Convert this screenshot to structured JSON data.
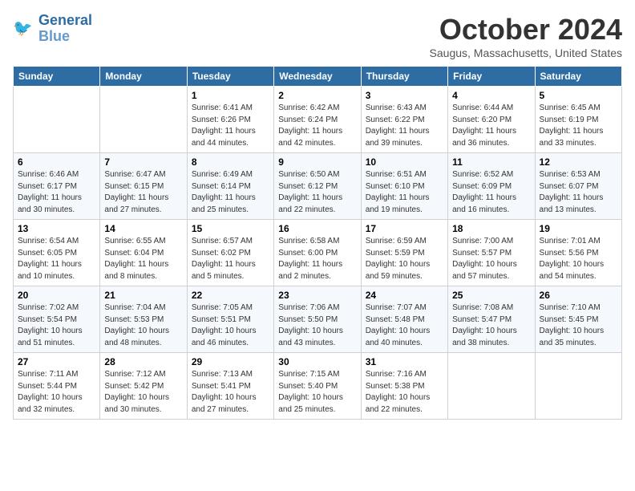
{
  "logo": {
    "line1": "General",
    "line2": "Blue"
  },
  "title": "October 2024",
  "location": "Saugus, Massachusetts, United States",
  "days_header": [
    "Sunday",
    "Monday",
    "Tuesday",
    "Wednesday",
    "Thursday",
    "Friday",
    "Saturday"
  ],
  "weeks": [
    [
      {
        "day": "",
        "sunrise": "",
        "sunset": "",
        "daylight": ""
      },
      {
        "day": "",
        "sunrise": "",
        "sunset": "",
        "daylight": ""
      },
      {
        "day": "1",
        "sunrise": "Sunrise: 6:41 AM",
        "sunset": "Sunset: 6:26 PM",
        "daylight": "Daylight: 11 hours and 44 minutes."
      },
      {
        "day": "2",
        "sunrise": "Sunrise: 6:42 AM",
        "sunset": "Sunset: 6:24 PM",
        "daylight": "Daylight: 11 hours and 42 minutes."
      },
      {
        "day": "3",
        "sunrise": "Sunrise: 6:43 AM",
        "sunset": "Sunset: 6:22 PM",
        "daylight": "Daylight: 11 hours and 39 minutes."
      },
      {
        "day": "4",
        "sunrise": "Sunrise: 6:44 AM",
        "sunset": "Sunset: 6:20 PM",
        "daylight": "Daylight: 11 hours and 36 minutes."
      },
      {
        "day": "5",
        "sunrise": "Sunrise: 6:45 AM",
        "sunset": "Sunset: 6:19 PM",
        "daylight": "Daylight: 11 hours and 33 minutes."
      }
    ],
    [
      {
        "day": "6",
        "sunrise": "Sunrise: 6:46 AM",
        "sunset": "Sunset: 6:17 PM",
        "daylight": "Daylight: 11 hours and 30 minutes."
      },
      {
        "day": "7",
        "sunrise": "Sunrise: 6:47 AM",
        "sunset": "Sunset: 6:15 PM",
        "daylight": "Daylight: 11 hours and 27 minutes."
      },
      {
        "day": "8",
        "sunrise": "Sunrise: 6:49 AM",
        "sunset": "Sunset: 6:14 PM",
        "daylight": "Daylight: 11 hours and 25 minutes."
      },
      {
        "day": "9",
        "sunrise": "Sunrise: 6:50 AM",
        "sunset": "Sunset: 6:12 PM",
        "daylight": "Daylight: 11 hours and 22 minutes."
      },
      {
        "day": "10",
        "sunrise": "Sunrise: 6:51 AM",
        "sunset": "Sunset: 6:10 PM",
        "daylight": "Daylight: 11 hours and 19 minutes."
      },
      {
        "day": "11",
        "sunrise": "Sunrise: 6:52 AM",
        "sunset": "Sunset: 6:09 PM",
        "daylight": "Daylight: 11 hours and 16 minutes."
      },
      {
        "day": "12",
        "sunrise": "Sunrise: 6:53 AM",
        "sunset": "Sunset: 6:07 PM",
        "daylight": "Daylight: 11 hours and 13 minutes."
      }
    ],
    [
      {
        "day": "13",
        "sunrise": "Sunrise: 6:54 AM",
        "sunset": "Sunset: 6:05 PM",
        "daylight": "Daylight: 11 hours and 10 minutes."
      },
      {
        "day": "14",
        "sunrise": "Sunrise: 6:55 AM",
        "sunset": "Sunset: 6:04 PM",
        "daylight": "Daylight: 11 hours and 8 minutes."
      },
      {
        "day": "15",
        "sunrise": "Sunrise: 6:57 AM",
        "sunset": "Sunset: 6:02 PM",
        "daylight": "Daylight: 11 hours and 5 minutes."
      },
      {
        "day": "16",
        "sunrise": "Sunrise: 6:58 AM",
        "sunset": "Sunset: 6:00 PM",
        "daylight": "Daylight: 11 hours and 2 minutes."
      },
      {
        "day": "17",
        "sunrise": "Sunrise: 6:59 AM",
        "sunset": "Sunset: 5:59 PM",
        "daylight": "Daylight: 10 hours and 59 minutes."
      },
      {
        "day": "18",
        "sunrise": "Sunrise: 7:00 AM",
        "sunset": "Sunset: 5:57 PM",
        "daylight": "Daylight: 10 hours and 57 minutes."
      },
      {
        "day": "19",
        "sunrise": "Sunrise: 7:01 AM",
        "sunset": "Sunset: 5:56 PM",
        "daylight": "Daylight: 10 hours and 54 minutes."
      }
    ],
    [
      {
        "day": "20",
        "sunrise": "Sunrise: 7:02 AM",
        "sunset": "Sunset: 5:54 PM",
        "daylight": "Daylight: 10 hours and 51 minutes."
      },
      {
        "day": "21",
        "sunrise": "Sunrise: 7:04 AM",
        "sunset": "Sunset: 5:53 PM",
        "daylight": "Daylight: 10 hours and 48 minutes."
      },
      {
        "day": "22",
        "sunrise": "Sunrise: 7:05 AM",
        "sunset": "Sunset: 5:51 PM",
        "daylight": "Daylight: 10 hours and 46 minutes."
      },
      {
        "day": "23",
        "sunrise": "Sunrise: 7:06 AM",
        "sunset": "Sunset: 5:50 PM",
        "daylight": "Daylight: 10 hours and 43 minutes."
      },
      {
        "day": "24",
        "sunrise": "Sunrise: 7:07 AM",
        "sunset": "Sunset: 5:48 PM",
        "daylight": "Daylight: 10 hours and 40 minutes."
      },
      {
        "day": "25",
        "sunrise": "Sunrise: 7:08 AM",
        "sunset": "Sunset: 5:47 PM",
        "daylight": "Daylight: 10 hours and 38 minutes."
      },
      {
        "day": "26",
        "sunrise": "Sunrise: 7:10 AM",
        "sunset": "Sunset: 5:45 PM",
        "daylight": "Daylight: 10 hours and 35 minutes."
      }
    ],
    [
      {
        "day": "27",
        "sunrise": "Sunrise: 7:11 AM",
        "sunset": "Sunset: 5:44 PM",
        "daylight": "Daylight: 10 hours and 32 minutes."
      },
      {
        "day": "28",
        "sunrise": "Sunrise: 7:12 AM",
        "sunset": "Sunset: 5:42 PM",
        "daylight": "Daylight: 10 hours and 30 minutes."
      },
      {
        "day": "29",
        "sunrise": "Sunrise: 7:13 AM",
        "sunset": "Sunset: 5:41 PM",
        "daylight": "Daylight: 10 hours and 27 minutes."
      },
      {
        "day": "30",
        "sunrise": "Sunrise: 7:15 AM",
        "sunset": "Sunset: 5:40 PM",
        "daylight": "Daylight: 10 hours and 25 minutes."
      },
      {
        "day": "31",
        "sunrise": "Sunrise: 7:16 AM",
        "sunset": "Sunset: 5:38 PM",
        "daylight": "Daylight: 10 hours and 22 minutes."
      },
      {
        "day": "",
        "sunrise": "",
        "sunset": "",
        "daylight": ""
      },
      {
        "day": "",
        "sunrise": "",
        "sunset": "",
        "daylight": ""
      }
    ]
  ]
}
